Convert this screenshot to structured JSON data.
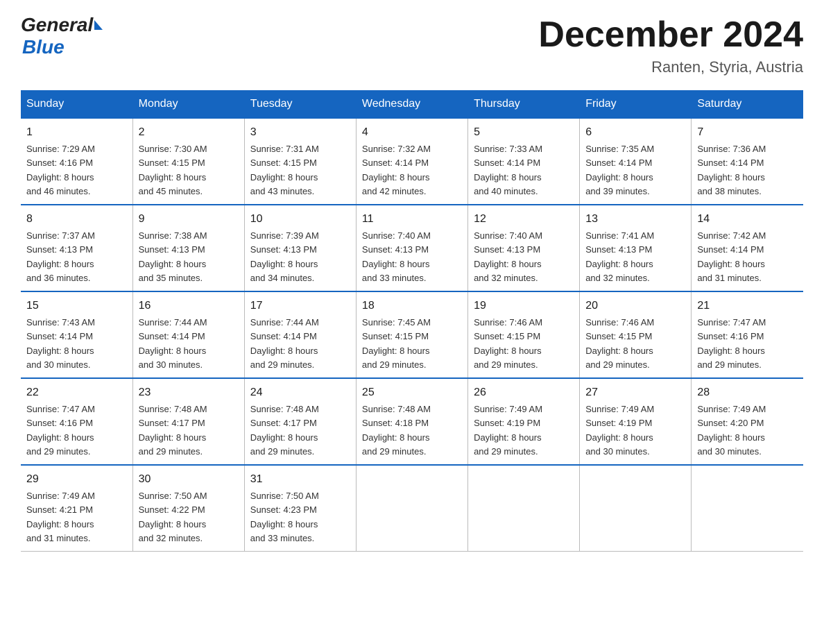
{
  "header": {
    "title": "December 2024",
    "location": "Ranten, Styria, Austria",
    "logo_general": "General",
    "logo_blue": "Blue"
  },
  "days_of_week": [
    "Sunday",
    "Monday",
    "Tuesday",
    "Wednesday",
    "Thursday",
    "Friday",
    "Saturday"
  ],
  "weeks": [
    [
      {
        "day": "1",
        "sunrise": "7:29 AM",
        "sunset": "4:16 PM",
        "daylight": "8 hours and 46 minutes."
      },
      {
        "day": "2",
        "sunrise": "7:30 AM",
        "sunset": "4:15 PM",
        "daylight": "8 hours and 45 minutes."
      },
      {
        "day": "3",
        "sunrise": "7:31 AM",
        "sunset": "4:15 PM",
        "daylight": "8 hours and 43 minutes."
      },
      {
        "day": "4",
        "sunrise": "7:32 AM",
        "sunset": "4:14 PM",
        "daylight": "8 hours and 42 minutes."
      },
      {
        "day": "5",
        "sunrise": "7:33 AM",
        "sunset": "4:14 PM",
        "daylight": "8 hours and 40 minutes."
      },
      {
        "day": "6",
        "sunrise": "7:35 AM",
        "sunset": "4:14 PM",
        "daylight": "8 hours and 39 minutes."
      },
      {
        "day": "7",
        "sunrise": "7:36 AM",
        "sunset": "4:14 PM",
        "daylight": "8 hours and 38 minutes."
      }
    ],
    [
      {
        "day": "8",
        "sunrise": "7:37 AM",
        "sunset": "4:13 PM",
        "daylight": "8 hours and 36 minutes."
      },
      {
        "day": "9",
        "sunrise": "7:38 AM",
        "sunset": "4:13 PM",
        "daylight": "8 hours and 35 minutes."
      },
      {
        "day": "10",
        "sunrise": "7:39 AM",
        "sunset": "4:13 PM",
        "daylight": "8 hours and 34 minutes."
      },
      {
        "day": "11",
        "sunrise": "7:40 AM",
        "sunset": "4:13 PM",
        "daylight": "8 hours and 33 minutes."
      },
      {
        "day": "12",
        "sunrise": "7:40 AM",
        "sunset": "4:13 PM",
        "daylight": "8 hours and 32 minutes."
      },
      {
        "day": "13",
        "sunrise": "7:41 AM",
        "sunset": "4:13 PM",
        "daylight": "8 hours and 32 minutes."
      },
      {
        "day": "14",
        "sunrise": "7:42 AM",
        "sunset": "4:14 PM",
        "daylight": "8 hours and 31 minutes."
      }
    ],
    [
      {
        "day": "15",
        "sunrise": "7:43 AM",
        "sunset": "4:14 PM",
        "daylight": "8 hours and 30 minutes."
      },
      {
        "day": "16",
        "sunrise": "7:44 AM",
        "sunset": "4:14 PM",
        "daylight": "8 hours and 30 minutes."
      },
      {
        "day": "17",
        "sunrise": "7:44 AM",
        "sunset": "4:14 PM",
        "daylight": "8 hours and 29 minutes."
      },
      {
        "day": "18",
        "sunrise": "7:45 AM",
        "sunset": "4:15 PM",
        "daylight": "8 hours and 29 minutes."
      },
      {
        "day": "19",
        "sunrise": "7:46 AM",
        "sunset": "4:15 PM",
        "daylight": "8 hours and 29 minutes."
      },
      {
        "day": "20",
        "sunrise": "7:46 AM",
        "sunset": "4:15 PM",
        "daylight": "8 hours and 29 minutes."
      },
      {
        "day": "21",
        "sunrise": "7:47 AM",
        "sunset": "4:16 PM",
        "daylight": "8 hours and 29 minutes."
      }
    ],
    [
      {
        "day": "22",
        "sunrise": "7:47 AM",
        "sunset": "4:16 PM",
        "daylight": "8 hours and 29 minutes."
      },
      {
        "day": "23",
        "sunrise": "7:48 AM",
        "sunset": "4:17 PM",
        "daylight": "8 hours and 29 minutes."
      },
      {
        "day": "24",
        "sunrise": "7:48 AM",
        "sunset": "4:17 PM",
        "daylight": "8 hours and 29 minutes."
      },
      {
        "day": "25",
        "sunrise": "7:48 AM",
        "sunset": "4:18 PM",
        "daylight": "8 hours and 29 minutes."
      },
      {
        "day": "26",
        "sunrise": "7:49 AM",
        "sunset": "4:19 PM",
        "daylight": "8 hours and 29 minutes."
      },
      {
        "day": "27",
        "sunrise": "7:49 AM",
        "sunset": "4:19 PM",
        "daylight": "8 hours and 30 minutes."
      },
      {
        "day": "28",
        "sunrise": "7:49 AM",
        "sunset": "4:20 PM",
        "daylight": "8 hours and 30 minutes."
      }
    ],
    [
      {
        "day": "29",
        "sunrise": "7:49 AM",
        "sunset": "4:21 PM",
        "daylight": "8 hours and 31 minutes."
      },
      {
        "day": "30",
        "sunrise": "7:50 AM",
        "sunset": "4:22 PM",
        "daylight": "8 hours and 32 minutes."
      },
      {
        "day": "31",
        "sunrise": "7:50 AM",
        "sunset": "4:23 PM",
        "daylight": "8 hours and 33 minutes."
      },
      null,
      null,
      null,
      null
    ]
  ],
  "sunrise_label": "Sunrise:",
  "sunset_label": "Sunset:",
  "daylight_label": "Daylight:"
}
